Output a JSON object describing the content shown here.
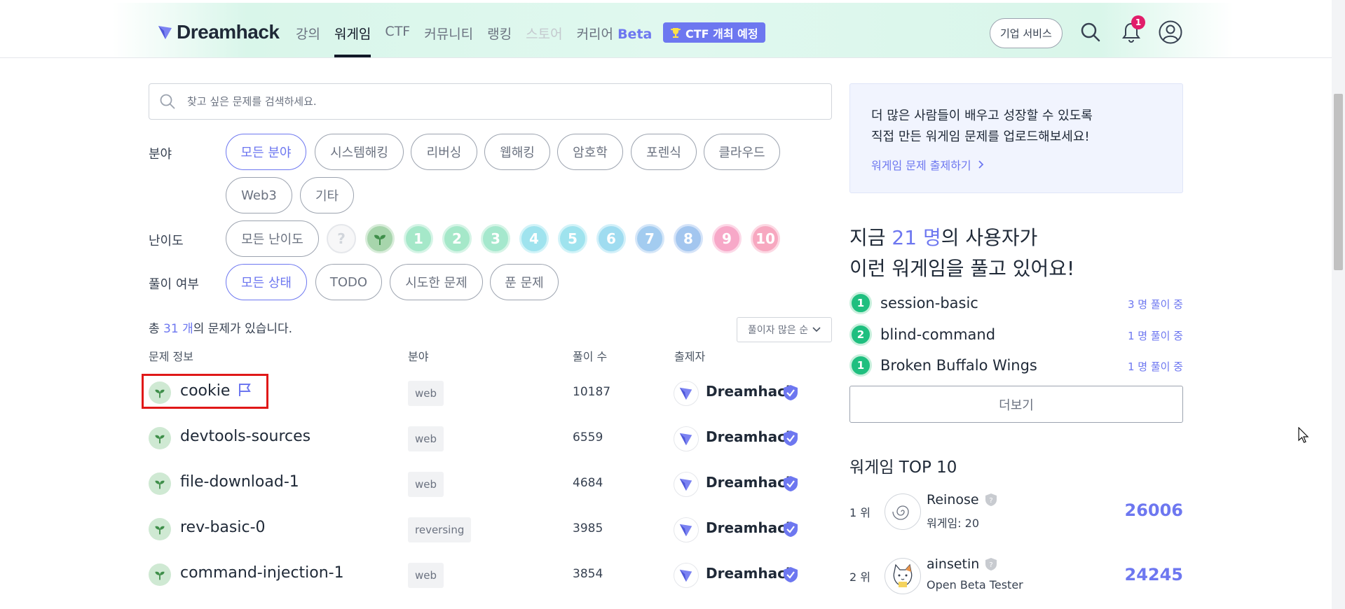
{
  "header": {
    "logo_text": "Dreamhack",
    "nav": [
      {
        "label": "강의",
        "state": "normal"
      },
      {
        "label": "워게임",
        "state": "active"
      },
      {
        "label": "CTF",
        "state": "normal"
      },
      {
        "label": "커뮤니티",
        "state": "normal"
      },
      {
        "label": "랭킹",
        "state": "normal"
      },
      {
        "label": "스토어",
        "state": "disabled"
      }
    ],
    "career_label": "커리어",
    "career_beta": "Beta",
    "ctf_badge": "CTF 개최 예정",
    "business_button": "기업 서비스",
    "notification_count": "1"
  },
  "search": {
    "placeholder": "찾고 싶은 문제를 검색하세요."
  },
  "filters": {
    "field_label": "분야",
    "fields": [
      "모든 분야",
      "시스템해킹",
      "리버싱",
      "웹해킹",
      "암호학",
      "포렌식",
      "클라우드",
      "Web3",
      "기타"
    ],
    "difficulty_label": "난이도",
    "difficulty_all": "모든 난이도",
    "difficulty_unknown": "?",
    "levels": [
      "1",
      "2",
      "3",
      "4",
      "5",
      "6",
      "7",
      "8",
      "9",
      "10"
    ],
    "status_label": "풀이 여부",
    "statuses": [
      "모든 상태",
      "TODO",
      "시도한 문제",
      "푼 문제"
    ]
  },
  "list": {
    "total_prefix": "총 ",
    "total_count": "31 개",
    "total_suffix": "의 문제가 있습니다.",
    "sort_label": "풀이자 많은 순",
    "columns": [
      "문제 정보",
      "분야",
      "풀이 수",
      "출제자"
    ],
    "rows": [
      {
        "title": "cookie",
        "tag": "web",
        "solves": "10187",
        "author": "Dreamhack"
      },
      {
        "title": "devtools-sources",
        "tag": "web",
        "solves": "6559",
        "author": "Dreamhack"
      },
      {
        "title": "file-download-1",
        "tag": "web",
        "solves": "4684",
        "author": "Dreamhack"
      },
      {
        "title": "rev-basic-0",
        "tag": "reversing",
        "solves": "3985",
        "author": "Dreamhack"
      },
      {
        "title": "command-injection-1",
        "tag": "web",
        "solves": "3854",
        "author": "Dreamhack"
      }
    ]
  },
  "promo": {
    "line1": "더 많은 사람들이 배우고 성장할 수 있도록",
    "line2": "직접 만든 워게임 문제를 업로드해보세요!",
    "link": "워게임 문제 출제하기"
  },
  "now_playing": {
    "line1_prefix": "지금 ",
    "user_count": "21 명",
    "line1_suffix": "의 사용자가",
    "line2": "이런 워게임을 풀고 있어요!",
    "items": [
      {
        "level": "1",
        "name": "session-basic",
        "count": "3 명 풀이 중"
      },
      {
        "level": "2",
        "name": "blind-command",
        "count": "1 명 풀이 중"
      },
      {
        "level": "1",
        "name": "Broken Buffalo Wings",
        "count": "1 명 풀이 중"
      }
    ],
    "more_button": "더보기"
  },
  "top10": {
    "title": "워게임 TOP 10",
    "items": [
      {
        "rank": "1 위",
        "name": "Reinose",
        "sub": "워게임: 20",
        "score": "26006"
      },
      {
        "rank": "2 위",
        "name": "ainsetin",
        "sub": "Open Beta Tester",
        "score": "24245"
      }
    ]
  },
  "colors": {
    "accent": "#6d77f0",
    "highlight": "#e01818"
  }
}
